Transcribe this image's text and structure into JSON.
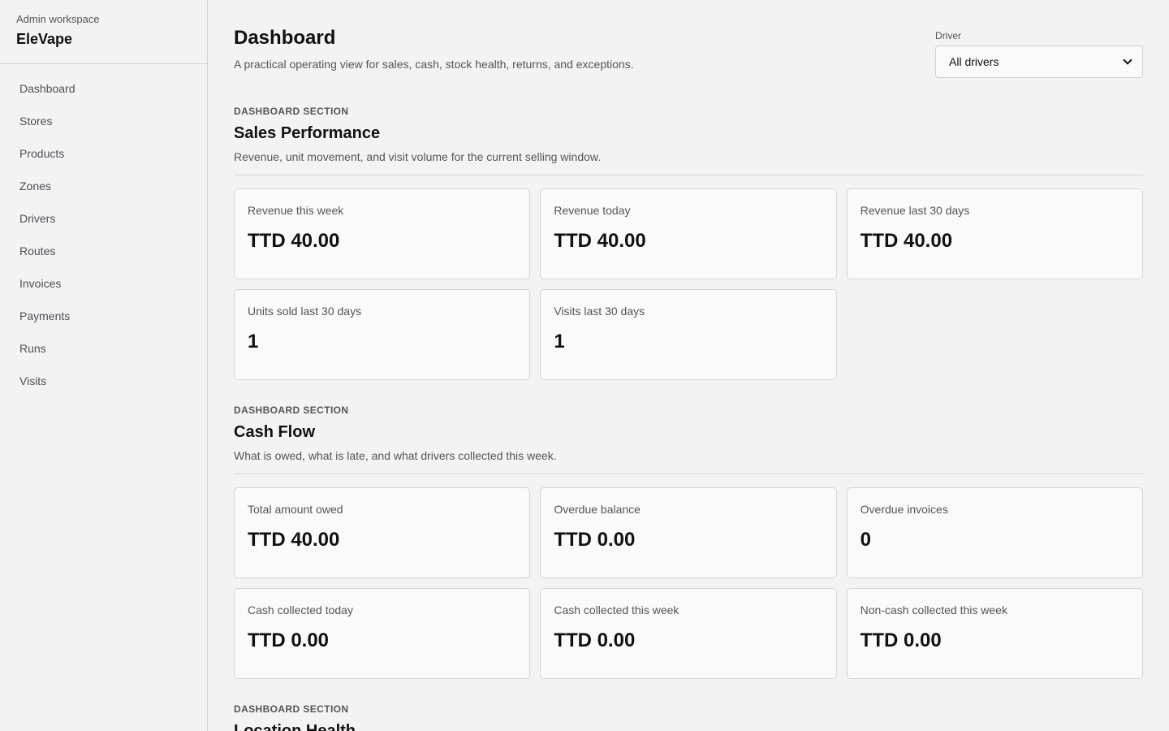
{
  "sidebar": {
    "kicker": "Admin workspace",
    "brand": "EleVape",
    "items": [
      {
        "label": "Dashboard"
      },
      {
        "label": "Stores"
      },
      {
        "label": "Products"
      },
      {
        "label": "Zones"
      },
      {
        "label": "Drivers"
      },
      {
        "label": "Routes"
      },
      {
        "label": "Invoices"
      },
      {
        "label": "Payments"
      },
      {
        "label": "Runs"
      },
      {
        "label": "Visits"
      }
    ]
  },
  "header": {
    "title": "Dashboard",
    "subtitle": "A practical operating view for sales, cash, stock health, returns, and exceptions.",
    "filter_label": "Driver",
    "filter_value": "All drivers"
  },
  "sections": [
    {
      "kicker": "Dashboard section",
      "title": "Sales Performance",
      "desc": "Revenue, unit movement, and visit volume for the current selling window.",
      "cards": [
        {
          "label": "Revenue this week",
          "value": "TTD 40.00"
        },
        {
          "label": "Revenue today",
          "value": "TTD 40.00"
        },
        {
          "label": "Revenue last 30 days",
          "value": "TTD 40.00"
        },
        {
          "label": "Units sold last 30 days",
          "value": "1"
        },
        {
          "label": "Visits last 30 days",
          "value": "1"
        }
      ]
    },
    {
      "kicker": "Dashboard section",
      "title": "Cash Flow",
      "desc": "What is owed, what is late, and what drivers collected this week.",
      "cards": [
        {
          "label": "Total amount owed",
          "value": "TTD 40.00"
        },
        {
          "label": "Overdue balance",
          "value": "TTD 0.00"
        },
        {
          "label": "Overdue invoices",
          "value": "0"
        },
        {
          "label": "Cash collected today",
          "value": "TTD 0.00"
        },
        {
          "label": "Cash collected this week",
          "value": "TTD 0.00"
        },
        {
          "label": "Non-cash collected this week",
          "value": "TTD 0.00"
        }
      ]
    },
    {
      "kicker": "Dashboard section",
      "title": "Location Health"
    }
  ]
}
